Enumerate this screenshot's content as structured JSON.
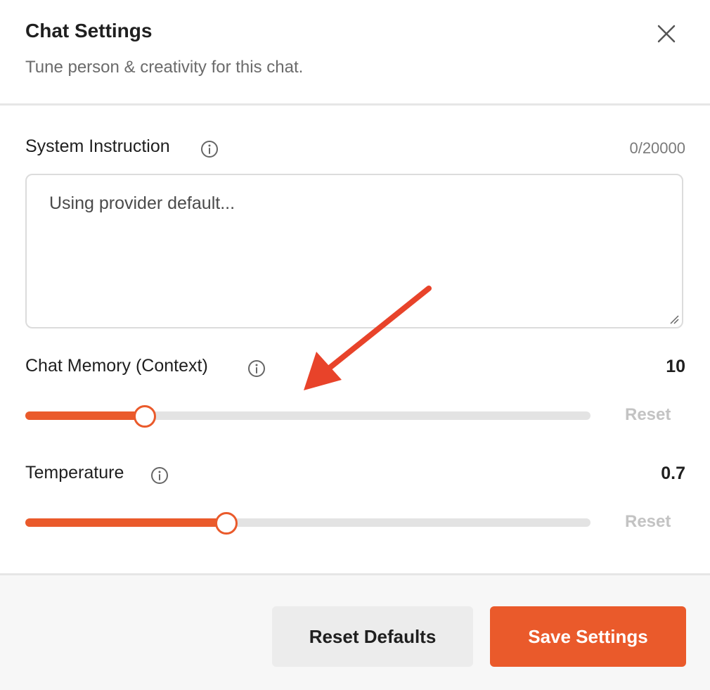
{
  "header": {
    "title": "Chat Settings",
    "subtitle": "Tune person & creativity for this chat."
  },
  "system_instruction": {
    "label": "System Instruction",
    "counter": "0/20000",
    "placeholder": "Using provider default..."
  },
  "chat_memory": {
    "label": "Chat Memory (Context)",
    "value": "10",
    "slider_fraction": 0.21,
    "reset_label": "Reset"
  },
  "temperature": {
    "label": "Temperature",
    "value": "0.7",
    "slider_fraction": 0.355,
    "reset_label": "Reset"
  },
  "footer": {
    "reset_defaults_label": "Reset Defaults",
    "save_label": "Save Settings"
  },
  "colors": {
    "accent": "#ea5a2b",
    "track": "#e3e3e3",
    "annotation_arrow": "#e8432a"
  },
  "icons": [
    "close-icon",
    "info-icon",
    "resize-grip-icon",
    "annotation-arrow"
  ]
}
